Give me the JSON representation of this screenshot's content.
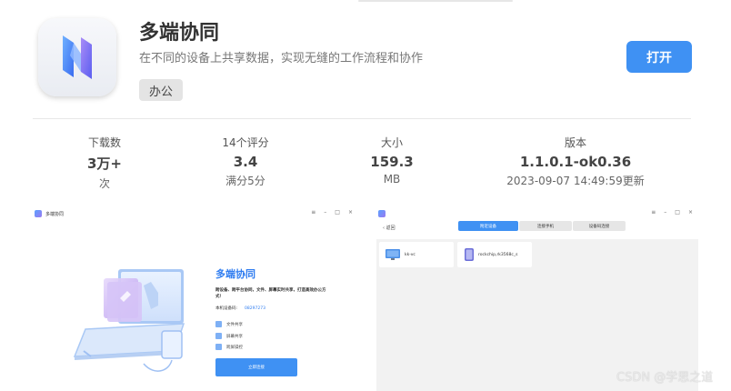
{
  "app": {
    "title": "多端协同",
    "description": "在不同的设备上共享数据，实现无缝的工作流程和协作",
    "category": "办公",
    "open_label": "打开"
  },
  "stats": [
    {
      "label": "下载数",
      "value": "3万+",
      "sub": "次"
    },
    {
      "label": "14个评分",
      "value": "3.4",
      "sub": "满分5分"
    },
    {
      "label": "大小",
      "value": "159.3",
      "sub": "MB"
    },
    {
      "label": "版本",
      "value": "1.1.0.1-ok0.36",
      "sub": "2023-09-07 14:49:59更新"
    }
  ],
  "screenshot1": {
    "window_title": "多端协同",
    "heading": "多端协同",
    "paragraph": "跨设备、跨平台协同，文件、屏幕实时共享，打造高效办公方式！",
    "device_label": "本机设备码:",
    "device_code": "08297273",
    "features": [
      "文件共享",
      "屏幕共享",
      "跨屏操控"
    ],
    "button": "立即连接",
    "controls": [
      "≡",
      "–",
      "□",
      "×"
    ]
  },
  "screenshot2": {
    "back_label": "‹  返回",
    "tabs": [
      "附近设备",
      "连接手机",
      "设备码连接"
    ],
    "devices": [
      "kk-vc",
      "rockchip,rk3568c_s"
    ],
    "controls": [
      "≡",
      "–",
      "□",
      "×"
    ]
  },
  "watermark": "CSDN @学思之道",
  "colors": {
    "accent": "#3f91f3",
    "heading_blue": "#2e7cf0"
  }
}
